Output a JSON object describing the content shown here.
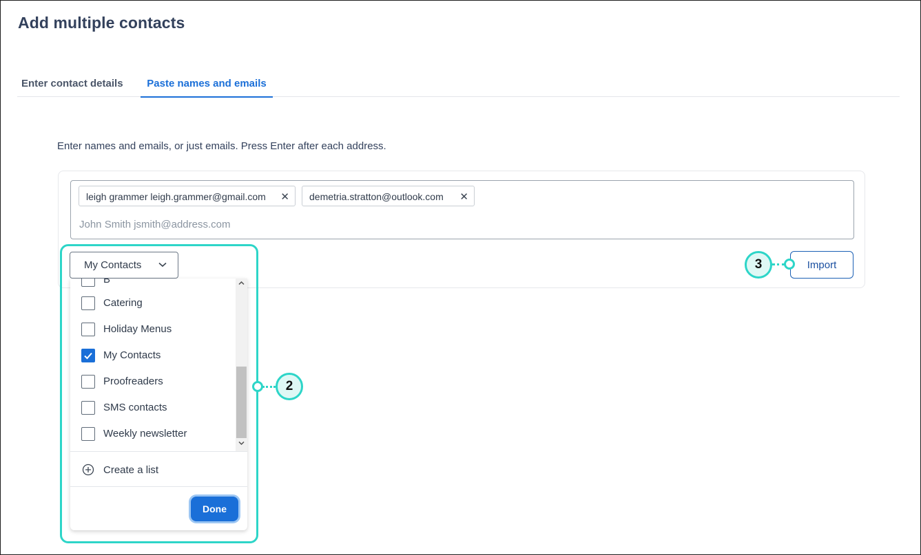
{
  "page": {
    "title": "Add multiple contacts"
  },
  "tabs": [
    {
      "label": "Enter contact details",
      "active": false
    },
    {
      "label": "Paste names and emails",
      "active": true
    }
  ],
  "instructions": "Enter names and emails, or just emails. Press Enter after each address.",
  "email_entry": {
    "chips": [
      {
        "text": "leigh grammer leigh.grammer@gmail.com"
      },
      {
        "text": "demetria.stratton@outlook.com"
      }
    ],
    "placeholder": "John Smith jsmith@address.com",
    "value": ""
  },
  "list_select": {
    "selected": "My Contacts"
  },
  "dropdown": {
    "items": [
      {
        "label": "B",
        "checked": false
      },
      {
        "label": "Catering",
        "checked": false
      },
      {
        "label": "Holiday Menus",
        "checked": false
      },
      {
        "label": "My Contacts",
        "checked": true
      },
      {
        "label": "Proofreaders",
        "checked": false
      },
      {
        "label": "SMS contacts",
        "checked": false
      },
      {
        "label": "Weekly newsletter",
        "checked": false
      }
    ],
    "create_list_label": "Create a list",
    "done_label": "Done"
  },
  "import_label": "Import",
  "callouts": {
    "two": "2",
    "three": "3"
  },
  "colors": {
    "accent": "#1a6fd8",
    "callout": "#2dd5c8",
    "title": "#33415c"
  }
}
